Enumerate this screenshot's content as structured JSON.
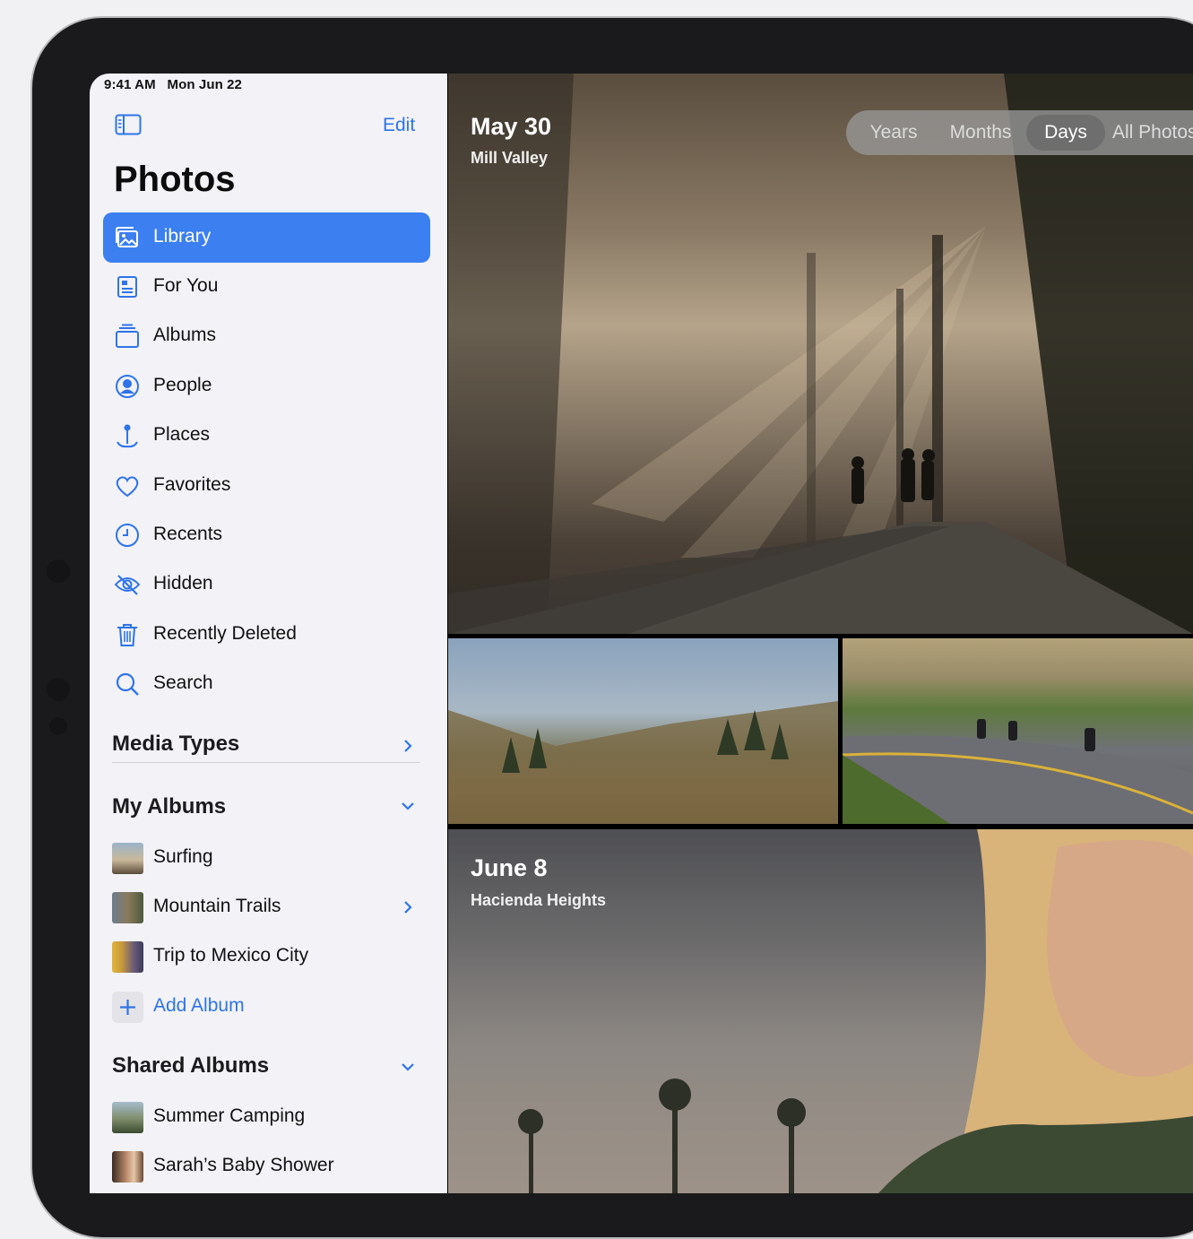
{
  "status_bar": {
    "time": "9:41 AM",
    "date": "Mon Jun 22"
  },
  "sidebar": {
    "edit_label": "Edit",
    "title": "Photos",
    "nav_items": [
      {
        "label": "Library",
        "icon": "library-icon",
        "selected": true
      },
      {
        "label": "For You",
        "icon": "for-you-icon"
      },
      {
        "label": "Albums",
        "icon": "albums-icon"
      },
      {
        "label": "People",
        "icon": "person-circle-icon"
      },
      {
        "label": "Places",
        "icon": "map-pin-icon"
      },
      {
        "label": "Favorites",
        "icon": "heart-icon"
      },
      {
        "label": "Recents",
        "icon": "clock-icon"
      },
      {
        "label": "Hidden",
        "icon": "eye-slash-icon"
      },
      {
        "label": "Recently Deleted",
        "icon": "trash-icon"
      },
      {
        "label": "Search",
        "icon": "search-icon"
      }
    ],
    "media_types": {
      "heading": "Media Types"
    },
    "my_albums": {
      "heading": "My Albums",
      "items": [
        {
          "label": "Surfing"
        },
        {
          "label": "Mountain Trails"
        },
        {
          "label": "Trip to Mexico City"
        }
      ],
      "add_label": "Add Album"
    },
    "shared_albums": {
      "heading": "Shared Albums",
      "items": [
        {
          "label": "Summer Camping"
        },
        {
          "label": "Sarah’s Baby Shower"
        }
      ]
    }
  },
  "content": {
    "segments": [
      "Years",
      "Months",
      "Days",
      "All Photos"
    ],
    "selected_segment": "Days",
    "days": [
      {
        "date": "May 30",
        "place": "Mill Valley"
      },
      {
        "date": "June 8",
        "place": "Hacienda Heights"
      }
    ]
  },
  "colors": {
    "accent": "#3b7ff0",
    "link": "#2f74e8",
    "sidebar_bg": "#f2f2f7"
  }
}
